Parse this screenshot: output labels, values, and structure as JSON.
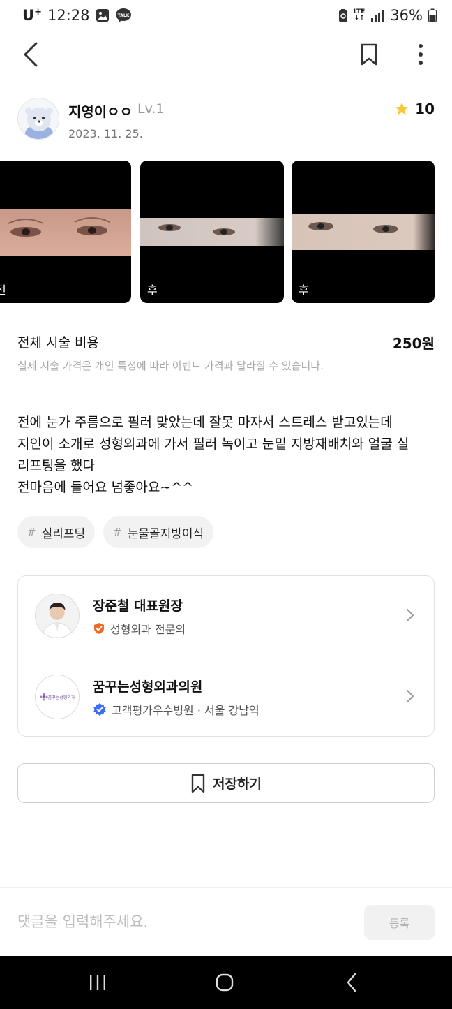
{
  "status_bar": {
    "carrier": "U",
    "carrier_sup": "+",
    "time": "12:28",
    "network_top": "LTE",
    "network_bottom": "↓↑",
    "battery": "36%"
  },
  "author": {
    "name": "지영이ㅇㅇ",
    "level": "Lv.1",
    "date": "2023. 11. 25.",
    "rating": "10",
    "star_color": "#f7c73e"
  },
  "photos": [
    {
      "label": "전"
    },
    {
      "label": "후"
    },
    {
      "label": "후"
    }
  ],
  "cost": {
    "label": "전체 시술 비용",
    "value": "250원",
    "note": "실제 시술 가격은 개인 특성에 따라 이벤트 가격과 달라질 수 있습니다."
  },
  "review": {
    "lines": [
      "전에 눈가 주름으로 필러 맞았는데 잘못 마자서 스트레스 받고있는데",
      "지인이 소개로 성형외과에 가서 필러 녹이고 눈밑 지방재배치와 얼굴 실",
      "리프팅을 했다",
      "전마음에 들어요 넘좋아요~^^"
    ]
  },
  "tags": [
    {
      "hash": "#",
      "label": "실리프팅"
    },
    {
      "hash": "#",
      "label": "눈물골지방이식"
    }
  ],
  "doctor": {
    "name": "장준철 대표원장",
    "badge": "성형외과 전문의",
    "badge_color": "#f26a21"
  },
  "clinic": {
    "name": "꿈꾸는성형외과의원",
    "badge": "고객평가우수병원 · 서울 강남역",
    "badge_color": "#3d6df2",
    "logo_text": "꿈꾸는성형외과"
  },
  "save_button": {
    "label": "저장하기"
  },
  "comment": {
    "placeholder": "댓글을 입력해주세요.",
    "submit_label": "등록"
  },
  "icons": {
    "back": "chevron-left-icon",
    "bookmark": "bookmark-icon",
    "more": "more-vertical-icon",
    "star": "star-icon",
    "chevron": "chevron-right-icon"
  }
}
